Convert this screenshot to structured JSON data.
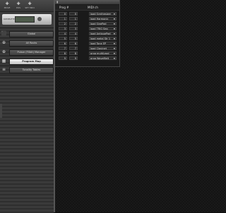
{
  "toolbar": {
    "buttons": [
      {
        "glyph": "✚",
        "label": "MOVE"
      },
      {
        "glyph": "✚",
        "label": "POS"
      },
      {
        "glyph": "✚",
        "label": "SET MIDI"
      }
    ]
  },
  "device": {
    "name": "KOMPLETE"
  },
  "nav": [
    {
      "icon": "⬛",
      "label": "Global"
    },
    {
      "icon": "⊕",
      "label": "All Racks"
    },
    {
      "icon": "⊕",
      "label": "Pulsar (FXbit) Manager"
    },
    {
      "icon": "▦",
      "label": "Program Map"
    },
    {
      "icon": "≡",
      "label": "Tonality Tables"
    }
  ],
  "table": {
    "header": {
      "col_prog": "Prog #",
      "col_midi": "MIDI ch"
    },
    "rows": [
      {
        "a": "0",
        "b": "0",
        "name": "load Synthesizer"
      },
      {
        "a": "1",
        "b": "1",
        "name": "load Harmonic"
      },
      {
        "a": "2",
        "b": "2",
        "name": "load SinePad"
      },
      {
        "a": "3",
        "b": "3",
        "name": "load TRIG Seq"
      },
      {
        "a": "4",
        "b": "4",
        "name": "load AntiquePad"
      },
      {
        "a": "5",
        "b": "5",
        "name": "load metal Str 1"
      },
      {
        "a": "6",
        "b": "6",
        "name": "load Tone EP"
      },
      {
        "a": "7",
        "b": "7",
        "name": "load Clavinet"
      },
      {
        "a": "8",
        "b": "8",
        "name": "prog multiLead"
      },
      {
        "a": "9",
        "b": "9",
        "name": "prog WaveMelt"
      }
    ]
  }
}
